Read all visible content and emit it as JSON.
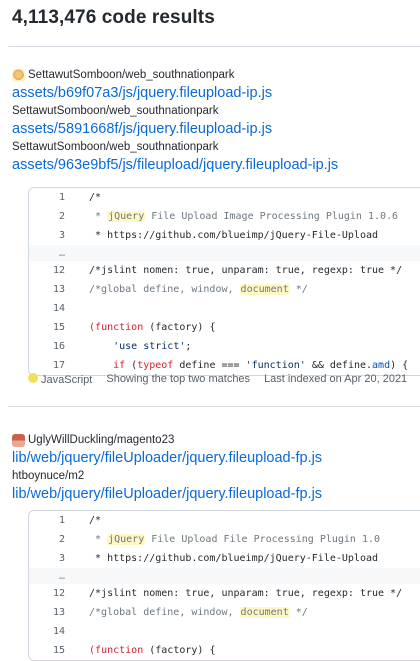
{
  "header": {
    "result_count": "4,113,476 code results"
  },
  "results": [
    {
      "repo": "SettawutSomboon/web_southnationpark",
      "file_link": "assets/b69f07a3/js/jquery.fileupload-ip.js",
      "also_repo_1": "SettawutSomboon/web_southnationpark",
      "also_link_1": "assets/5891668f/js/jquery.fileupload-ip.js",
      "also_repo_2": "SettawutSomboon/web_southnationpark",
      "also_link_2": "assets/963e9bf5/js/fileupload/jquery.fileupload-ip.js",
      "code_lines": {
        "l1": {
          "n": "1",
          "text": " /*"
        },
        "l2": {
          "n": "2",
          "pre": "  * ",
          "hl": "jQuery",
          "post": " File Upload Image Processing Plugin 1.0.6"
        },
        "l3": {
          "n": "3",
          "text": "  * https://github.com/blueimp/jQuery-File-Upload"
        },
        "gap": {
          "n": "…"
        },
        "l12": {
          "n": "12",
          "text": " /*jslint nomen: true, unparam: true, regexp: true */"
        },
        "l13": {
          "n": "13",
          "pre": " /*global define, window, ",
          "hl": "document",
          "post": " */"
        },
        "l14": {
          "n": "14"
        },
        "l15": {
          "n": "15",
          "k": "(function",
          "rest": " (factory) {"
        },
        "l16": {
          "n": "16",
          "s": "'use strict'",
          "rest": ";"
        },
        "l17": {
          "n": "17",
          "k1": "if",
          "p1": " (",
          "k2": "typeof",
          "p2": " define === ",
          "s": "'function'",
          "p3": " && define.",
          "v": "amd",
          "p4": ") {"
        }
      },
      "meta": {
        "language": "JavaScript",
        "language_color": "#f1e05a",
        "matches": "Showing the top two matches",
        "indexed": "Last indexed on Apr 20, 2021"
      }
    },
    {
      "repo": "UglyWillDuckling/magento23",
      "file_link": "lib/web/jquery/fileUploader/jquery.fileupload-fp.js",
      "also_repo_1": "htboynuce/m2",
      "also_link_1": "lib/web/jquery/fileUploader/jquery.fileupload-fp.js",
      "code_lines": {
        "l1": {
          "n": "1",
          "text": " /*"
        },
        "l2": {
          "n": "2",
          "pre": "  * ",
          "hl": "jQuery",
          "post": " File Upload File Processing Plugin 1.0"
        },
        "l3": {
          "n": "3",
          "text": "  * https://github.com/blueimp/jQuery-File-Upload"
        },
        "gap": {
          "n": "…"
        },
        "l12": {
          "n": "12",
          "text": " /*jslint nomen: true, unparam: true, regexp: true */"
        },
        "l13": {
          "n": "13",
          "pre": " /*global define, window, ",
          "hl": "document",
          "post": " */"
        },
        "l14": {
          "n": "14"
        },
        "l15": {
          "n": "15",
          "k": "(function",
          "rest": " (factory) {"
        }
      }
    }
  ]
}
